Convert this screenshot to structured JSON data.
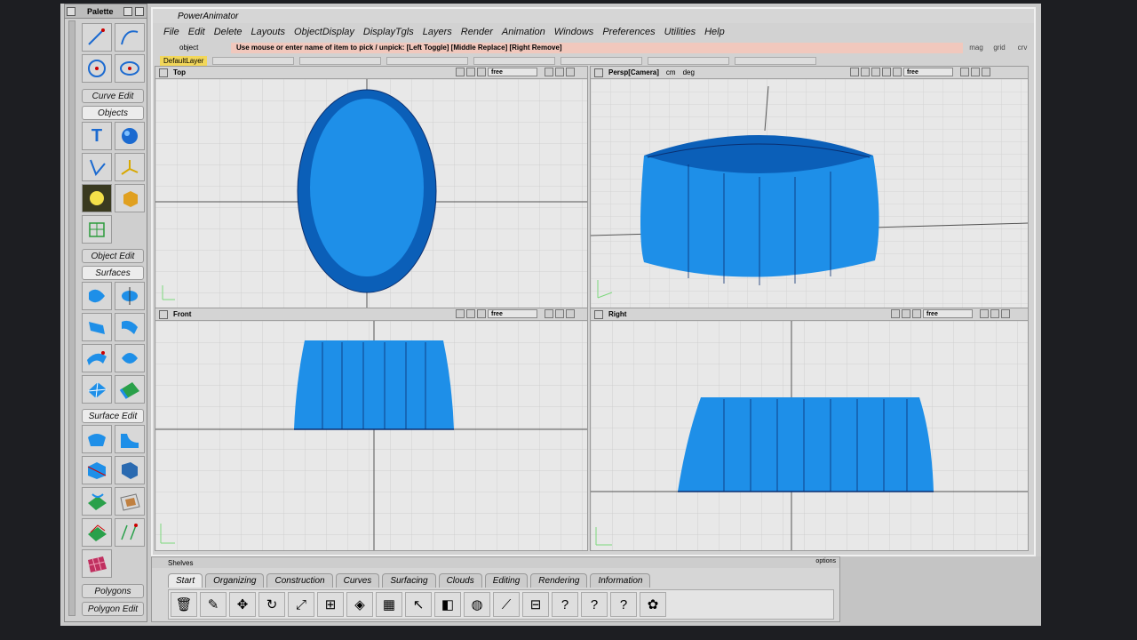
{
  "palette": {
    "title": "Palette",
    "sections": {
      "curve_edit": "Curve Edit",
      "objects": "Objects",
      "object_edit": "Object Edit",
      "surfaces": "Surfaces",
      "surface_edit": "Surface Edit",
      "polygons": "Polygons",
      "polygon_edit": "Polygon Edit"
    }
  },
  "window": {
    "title": "PowerAnimator",
    "menu": [
      "File",
      "Edit",
      "Delete",
      "Layouts",
      "ObjectDisplay",
      "DisplayTgls",
      "Layers",
      "Render",
      "Animation",
      "Windows",
      "Preferences",
      "Utilities",
      "Help"
    ],
    "prompt_label": "object",
    "prompt_message": "Use mouse or enter name of item to pick / unpick: [Left Toggle] [Middle Replace] [Right Remove]",
    "prompt_buttons": [
      "mag",
      "grid",
      "crv"
    ],
    "layer": "DefaultLayer"
  },
  "viewports": {
    "top": {
      "label": "Top",
      "mode": "free"
    },
    "persp": {
      "label": "Persp[Camera]",
      "units_a": "cm",
      "units_b": "deg",
      "mode": "free"
    },
    "front": {
      "label": "Front",
      "mode": "free"
    },
    "right": {
      "label": "Right",
      "mode": "free"
    }
  },
  "shelves": {
    "title": "Shelves",
    "options": "options",
    "tabs": [
      "Start",
      "Organizing",
      "Construction",
      "Curves",
      "Surfacing",
      "Clouds",
      "Editing",
      "Rendering",
      "Information"
    ]
  },
  "colors": {
    "surface": "#1e8fe8",
    "surface_dark": "#0b5fb8",
    "grid": "#cfcfcf",
    "prompt": "#f1c8bd",
    "layer": "#f2d75a"
  }
}
